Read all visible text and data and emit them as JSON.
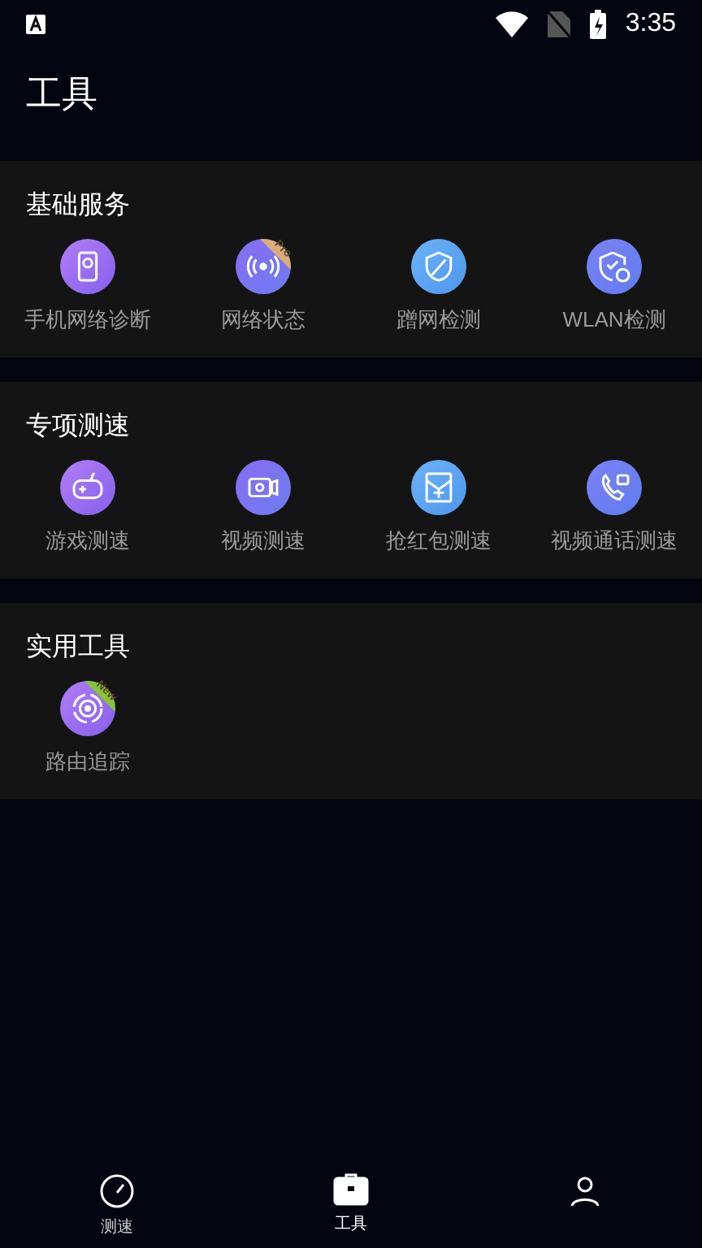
{
  "status_bar": {
    "time": "3:35"
  },
  "header": {
    "title": "工具"
  },
  "sections": [
    {
      "title": "基础服务",
      "items": [
        {
          "label": "手机网络诊断"
        },
        {
          "label": "网络状态",
          "badge": "Pro"
        },
        {
          "label": "蹭网检测"
        },
        {
          "label": "WLAN检测"
        }
      ]
    },
    {
      "title": "专项测速",
      "items": [
        {
          "label": "游戏测速"
        },
        {
          "label": "视频测速"
        },
        {
          "label": "抢红包测速"
        },
        {
          "label": "视频通话测速"
        }
      ]
    },
    {
      "title": "实用工具",
      "items": [
        {
          "label": "路由追踪",
          "badge": "New"
        }
      ]
    }
  ],
  "bottom_nav": [
    {
      "label": "测速",
      "selected": false
    },
    {
      "label": "工具",
      "selected": true
    },
    {
      "selected": false
    }
  ]
}
